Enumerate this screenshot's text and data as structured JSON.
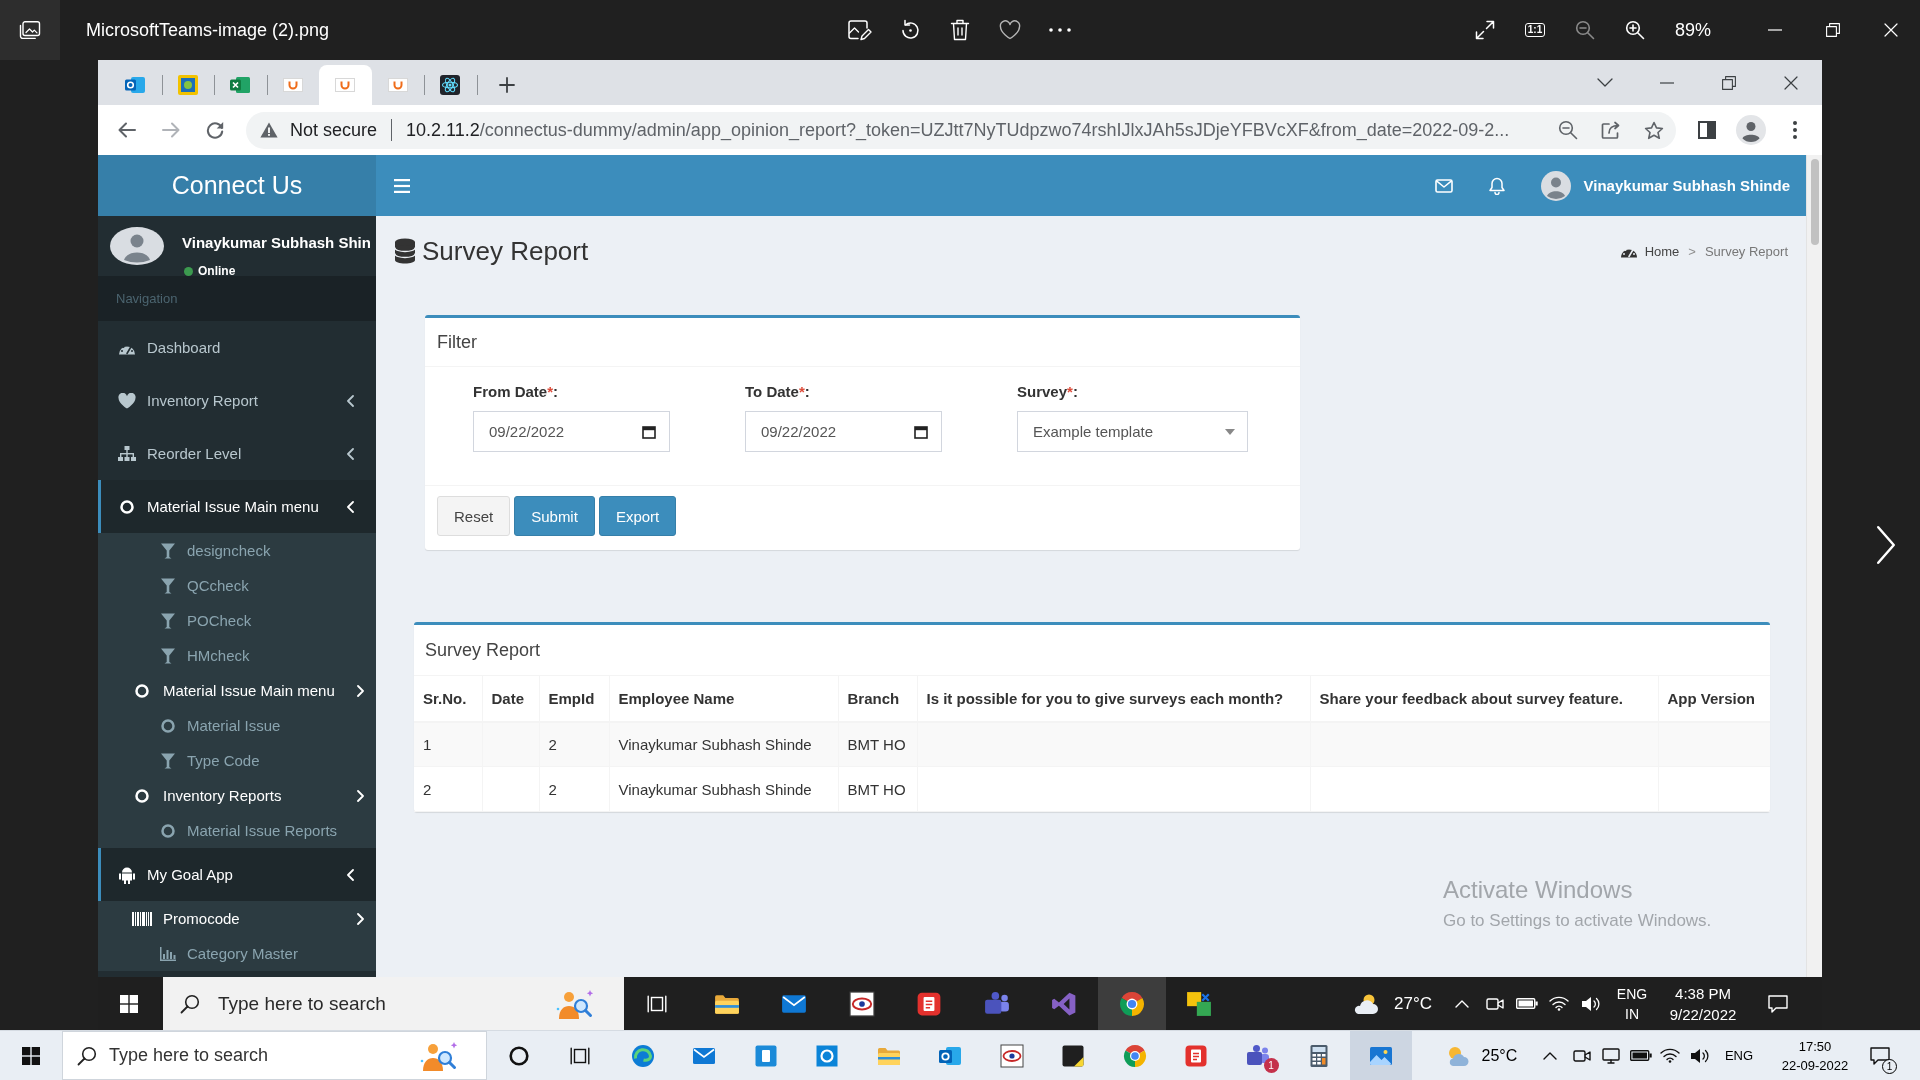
{
  "viewer": {
    "title": "MicrosoftTeams-image (2).png",
    "actual_size": "1:1",
    "zoom": "89%"
  },
  "browser": {
    "tabs": [
      {
        "selected": false
      },
      {
        "selected": false
      },
      {
        "selected": false
      },
      {
        "selected": false
      },
      {
        "selected": true
      },
      {
        "selected": false
      },
      {
        "selected": false
      }
    ],
    "security": "Not secure",
    "url_host": "10.2.11.2",
    "url_rest": "/connectus-dummy/admin/app_opinion_report?_token=UZJtt7NyTUdpzwo74rshIJlxJAh5sJDjeYFBVcXF&from_date=2022-09-2..."
  },
  "sidebar": {
    "brand": "Connect Us",
    "user": {
      "name": "Vinaykumar Subhash Shin",
      "status": "Online"
    },
    "header": "Navigation",
    "items": [
      {
        "label": "Dashboard",
        "kind": "link",
        "expanded": false
      },
      {
        "label": "Inventory Report",
        "kind": "tree",
        "expanded": false
      },
      {
        "label": "Reorder Level",
        "kind": "tree",
        "expanded": false
      },
      {
        "label": "Material Issue Main menu",
        "kind": "tree",
        "expanded": true,
        "children": [
          {
            "label": "designcheck",
            "kind": "link",
            "expanded": false
          },
          {
            "label": "QCcheck",
            "kind": "link",
            "expanded": false
          },
          {
            "label": "POCheck",
            "kind": "link",
            "expanded": false
          },
          {
            "label": "HMcheck",
            "kind": "link",
            "expanded": false
          },
          {
            "label": "Material Issue Main menu",
            "kind": "tree",
            "expanded": true,
            "children": [
              {
                "label": "Material Issue",
                "kind": "link",
                "expanded": false
              },
              {
                "label": "Type Code",
                "kind": "link",
                "expanded": false
              }
            ]
          },
          {
            "label": "Inventory Reports",
            "kind": "tree",
            "expanded": true,
            "children": [
              {
                "label": "Material Issue Reports",
                "kind": "link",
                "expanded": false
              }
            ]
          }
        ]
      },
      {
        "label": "My Goal App",
        "kind": "tree",
        "expanded": true,
        "children": [
          {
            "label": "Promocode",
            "kind": "tree",
            "expanded": true,
            "children": [
              {
                "label": "Category Master",
                "kind": "link",
                "expanded": false
              }
            ]
          }
        ]
      }
    ]
  },
  "header": {
    "user_name": "Vinaykumar Subhash Shinde"
  },
  "content": {
    "title": "Survey Report",
    "breadcrumb": {
      "separator": ">",
      "items": [
        {
          "label": "Home",
          "current": false
        },
        {
          "label": "Survey Report",
          "current": true
        }
      ]
    }
  },
  "filter": {
    "title": "Filter",
    "fields": [
      {
        "label": "From Date",
        "required_mark": "*",
        "label_end": ":",
        "kind": "date",
        "value": "09/22/2022"
      },
      {
        "label": "To Date",
        "required_mark": "*",
        "label_end": ":",
        "kind": "date",
        "value": "09/22/2022"
      },
      {
        "label": "Survey",
        "required_mark": "*",
        "label_end": ":",
        "kind": "select",
        "value": "Example template"
      }
    ],
    "buttons": [
      {
        "label": "Reset",
        "kind": "default"
      },
      {
        "label": "Submit",
        "kind": "primary"
      },
      {
        "label": "Export",
        "kind": "primary"
      }
    ]
  },
  "report": {
    "title": "Survey Report",
    "columns": [
      "Sr.No.",
      "Date",
      "EmpId",
      "Employee Name",
      "Branch",
      "Is it possible for you to give surveys each month?",
      "Share your feedback about survey feature.",
      "App Version"
    ],
    "rows": [
      {
        "sr_no": "1",
        "empid": "2",
        "employee_name": "Vinaykumar Subhash Shinde",
        "branch": "BMT HO"
      },
      {
        "sr_no": "2",
        "empid": "2",
        "employee_name": "Vinaykumar Subhash Shinde",
        "branch": "BMT HO"
      }
    ]
  },
  "activation": {
    "title": "Activate Windows",
    "hint": "Go to Settings to activate Windows."
  },
  "inner_taskbar": {
    "search": {
      "placeholder": "Type here to search"
    },
    "apps": [
      {
        "selected": false
      },
      {
        "selected": false
      },
      {
        "selected": false
      },
      {
        "selected": false
      },
      {
        "selected": false
      },
      {
        "selected": false
      },
      {
        "selected": true
      },
      {
        "selected": false
      }
    ],
    "weather": "27°C",
    "language": "ENG",
    "region": "IN",
    "time": "4:38 PM",
    "date": "9/22/2022"
  },
  "taskbar": {
    "search": {
      "placeholder": "Type here to search"
    },
    "apps": [
      {
        "selected": false
      },
      {
        "selected": false
      },
      {
        "selected": false
      },
      {
        "selected": false
      },
      {
        "selected": false
      },
      {
        "selected": false
      },
      {
        "selected": false
      },
      {
        "selected": false
      },
      {
        "selected": false
      },
      {
        "selected": false
      },
      {
        "selected": false,
        "badge": "1"
      },
      {
        "selected": false
      },
      {
        "selected": true
      }
    ],
    "weather": "25°C",
    "language": "ENG",
    "time": "17:50",
    "date": "22-09-2022",
    "notifications": "1"
  }
}
